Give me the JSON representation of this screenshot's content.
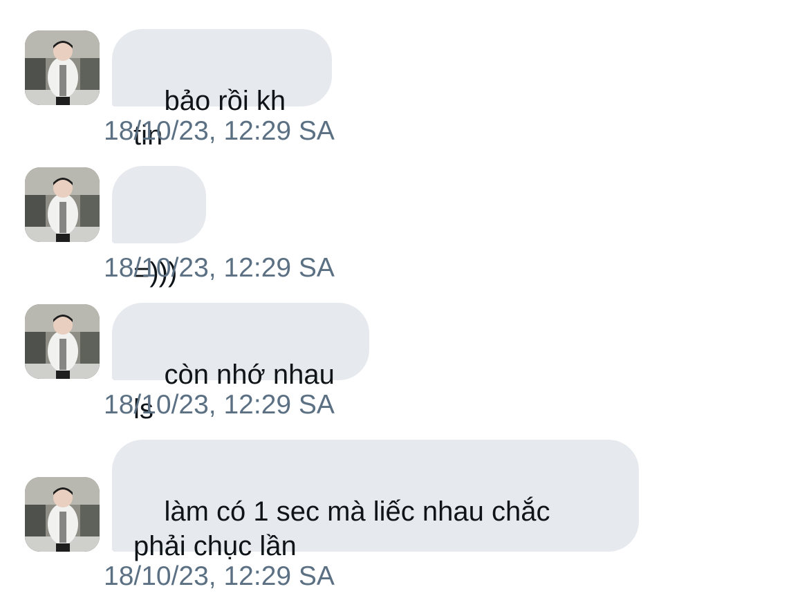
{
  "messages": [
    {
      "text": "bảo rồi kh tin",
      "timestamp": "18/10/23, 12:29 SA"
    },
    {
      "text": "=)))",
      "timestamp": "18/10/23, 12:29 SA"
    },
    {
      "text": "còn nhớ nhau ls",
      "timestamp": "18/10/23, 12:29 SA"
    },
    {
      "text": "làm có 1 sec mà liếc nhau chắc\nphải chục lần",
      "timestamp": "18/10/23, 12:29 SA"
    }
  ],
  "colors": {
    "bubble": "#e6e9ed",
    "text": "#0f1419",
    "timestamp": "#5b7083"
  }
}
